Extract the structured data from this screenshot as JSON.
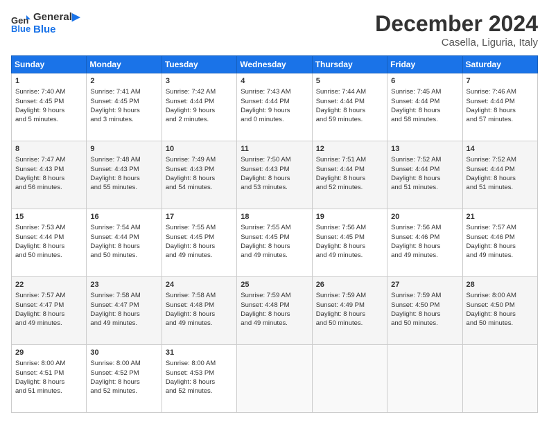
{
  "header": {
    "logo_line1": "General",
    "logo_line2": "Blue",
    "month": "December 2024",
    "location": "Casella, Liguria, Italy"
  },
  "days_of_week": [
    "Sunday",
    "Monday",
    "Tuesday",
    "Wednesday",
    "Thursday",
    "Friday",
    "Saturday"
  ],
  "weeks": [
    [
      {
        "day": "1",
        "info": "Sunrise: 7:40 AM\nSunset: 4:45 PM\nDaylight: 9 hours\nand 5 minutes."
      },
      {
        "day": "2",
        "info": "Sunrise: 7:41 AM\nSunset: 4:45 PM\nDaylight: 9 hours\nand 3 minutes."
      },
      {
        "day": "3",
        "info": "Sunrise: 7:42 AM\nSunset: 4:44 PM\nDaylight: 9 hours\nand 2 minutes."
      },
      {
        "day": "4",
        "info": "Sunrise: 7:43 AM\nSunset: 4:44 PM\nDaylight: 9 hours\nand 0 minutes."
      },
      {
        "day": "5",
        "info": "Sunrise: 7:44 AM\nSunset: 4:44 PM\nDaylight: 8 hours\nand 59 minutes."
      },
      {
        "day": "6",
        "info": "Sunrise: 7:45 AM\nSunset: 4:44 PM\nDaylight: 8 hours\nand 58 minutes."
      },
      {
        "day": "7",
        "info": "Sunrise: 7:46 AM\nSunset: 4:44 PM\nDaylight: 8 hours\nand 57 minutes."
      }
    ],
    [
      {
        "day": "8",
        "info": "Sunrise: 7:47 AM\nSunset: 4:43 PM\nDaylight: 8 hours\nand 56 minutes."
      },
      {
        "day": "9",
        "info": "Sunrise: 7:48 AM\nSunset: 4:43 PM\nDaylight: 8 hours\nand 55 minutes."
      },
      {
        "day": "10",
        "info": "Sunrise: 7:49 AM\nSunset: 4:43 PM\nDaylight: 8 hours\nand 54 minutes."
      },
      {
        "day": "11",
        "info": "Sunrise: 7:50 AM\nSunset: 4:43 PM\nDaylight: 8 hours\nand 53 minutes."
      },
      {
        "day": "12",
        "info": "Sunrise: 7:51 AM\nSunset: 4:44 PM\nDaylight: 8 hours\nand 52 minutes."
      },
      {
        "day": "13",
        "info": "Sunrise: 7:52 AM\nSunset: 4:44 PM\nDaylight: 8 hours\nand 51 minutes."
      },
      {
        "day": "14",
        "info": "Sunrise: 7:52 AM\nSunset: 4:44 PM\nDaylight: 8 hours\nand 51 minutes."
      }
    ],
    [
      {
        "day": "15",
        "info": "Sunrise: 7:53 AM\nSunset: 4:44 PM\nDaylight: 8 hours\nand 50 minutes."
      },
      {
        "day": "16",
        "info": "Sunrise: 7:54 AM\nSunset: 4:44 PM\nDaylight: 8 hours\nand 50 minutes."
      },
      {
        "day": "17",
        "info": "Sunrise: 7:55 AM\nSunset: 4:45 PM\nDaylight: 8 hours\nand 49 minutes."
      },
      {
        "day": "18",
        "info": "Sunrise: 7:55 AM\nSunset: 4:45 PM\nDaylight: 8 hours\nand 49 minutes."
      },
      {
        "day": "19",
        "info": "Sunrise: 7:56 AM\nSunset: 4:45 PM\nDaylight: 8 hours\nand 49 minutes."
      },
      {
        "day": "20",
        "info": "Sunrise: 7:56 AM\nSunset: 4:46 PM\nDaylight: 8 hours\nand 49 minutes."
      },
      {
        "day": "21",
        "info": "Sunrise: 7:57 AM\nSunset: 4:46 PM\nDaylight: 8 hours\nand 49 minutes."
      }
    ],
    [
      {
        "day": "22",
        "info": "Sunrise: 7:57 AM\nSunset: 4:47 PM\nDaylight: 8 hours\nand 49 minutes."
      },
      {
        "day": "23",
        "info": "Sunrise: 7:58 AM\nSunset: 4:47 PM\nDaylight: 8 hours\nand 49 minutes."
      },
      {
        "day": "24",
        "info": "Sunrise: 7:58 AM\nSunset: 4:48 PM\nDaylight: 8 hours\nand 49 minutes."
      },
      {
        "day": "25",
        "info": "Sunrise: 7:59 AM\nSunset: 4:48 PM\nDaylight: 8 hours\nand 49 minutes."
      },
      {
        "day": "26",
        "info": "Sunrise: 7:59 AM\nSunset: 4:49 PM\nDaylight: 8 hours\nand 50 minutes."
      },
      {
        "day": "27",
        "info": "Sunrise: 7:59 AM\nSunset: 4:50 PM\nDaylight: 8 hours\nand 50 minutes."
      },
      {
        "day": "28",
        "info": "Sunrise: 8:00 AM\nSunset: 4:50 PM\nDaylight: 8 hours\nand 50 minutes."
      }
    ],
    [
      {
        "day": "29",
        "info": "Sunrise: 8:00 AM\nSunset: 4:51 PM\nDaylight: 8 hours\nand 51 minutes."
      },
      {
        "day": "30",
        "info": "Sunrise: 8:00 AM\nSunset: 4:52 PM\nDaylight: 8 hours\nand 52 minutes."
      },
      {
        "day": "31",
        "info": "Sunrise: 8:00 AM\nSunset: 4:53 PM\nDaylight: 8 hours\nand 52 minutes."
      },
      null,
      null,
      null,
      null
    ]
  ]
}
